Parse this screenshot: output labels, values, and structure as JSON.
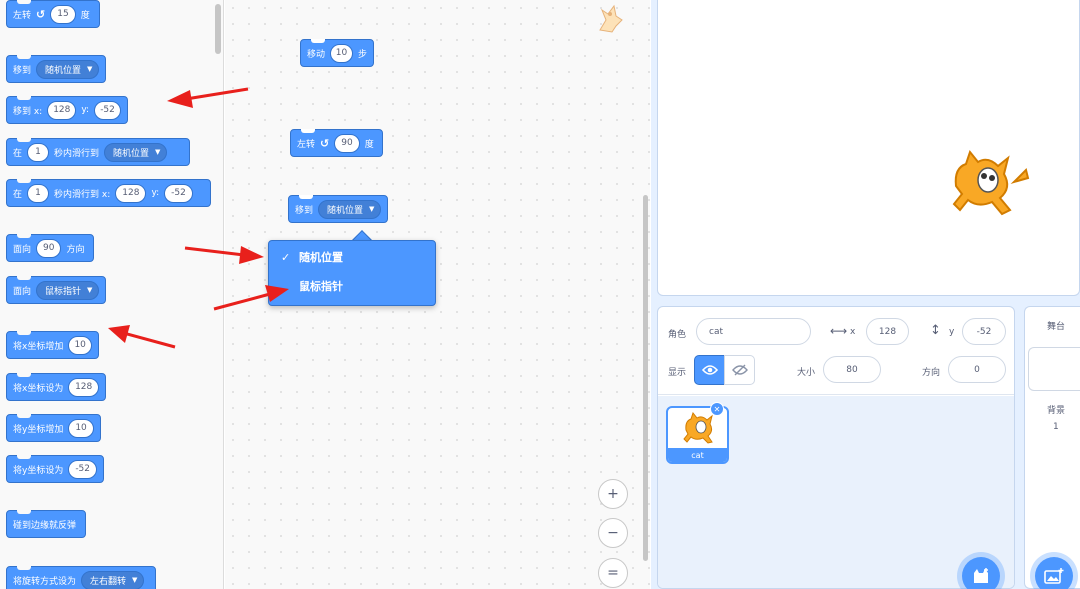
{
  "palette": {
    "turn_left": {
      "label": "左转",
      "value": "15",
      "unit": "度"
    },
    "goto_menu": {
      "label": "移到",
      "option": "随机位置"
    },
    "goto_xy": {
      "label": "移到 x:",
      "x": "128",
      "ylabel": "y:",
      "y": "-52"
    },
    "glide_menu": {
      "prefix": "在",
      "secs": "1",
      "label": "秒内滑行到",
      "option": "随机位置"
    },
    "glide_xy": {
      "prefix": "在",
      "secs": "1",
      "label": "秒内滑行到 x:",
      "x": "128",
      "ylabel": "y:",
      "y": "-52"
    },
    "point_dir": {
      "label": "面向",
      "value": "90",
      "unit": "方向"
    },
    "point_towards": {
      "label": "面向",
      "option": "鼠标指针"
    },
    "change_x": {
      "label": "将x坐标增加",
      "value": "10"
    },
    "set_x": {
      "label": "将x坐标设为",
      "value": "128"
    },
    "change_y": {
      "label": "将y坐标增加",
      "value": "10"
    },
    "set_y": {
      "label": "将y坐标设为",
      "value": "-52"
    },
    "bounce": {
      "label": "碰到边缘就反弹"
    },
    "rotation_style": {
      "label": "将旋转方式设为",
      "option": "左右翻转"
    }
  },
  "canvas": {
    "move": {
      "label": "移动",
      "value": "10",
      "unit": "步"
    },
    "turn": {
      "label": "左转",
      "value": "90",
      "unit": "度"
    },
    "goto": {
      "label": "移到",
      "option": "随机位置"
    },
    "dropdown": {
      "items": [
        {
          "check": "✓",
          "label": "随机位置"
        },
        {
          "check": "",
          "label": "鼠标指针"
        }
      ]
    },
    "zoom": {
      "in": "+",
      "out": "−",
      "reset": "="
    }
  },
  "sprite_info": {
    "sprite_label": "角色",
    "name": "cat",
    "x_label": "x",
    "x": "128",
    "y_label": "y",
    "y": "-52",
    "show_label": "显示",
    "size_label": "大小",
    "size": "80",
    "direction_label": "方向",
    "direction": "0"
  },
  "sprites": [
    {
      "name": "cat"
    }
  ],
  "stage_pane": {
    "title": "舞台",
    "backdrops_label": "背景",
    "backdrops_count": "1"
  },
  "colors": {
    "motion_blue": "#4c97ff",
    "motion_border": "#3373cc",
    "arrow_red": "#e8201c"
  }
}
